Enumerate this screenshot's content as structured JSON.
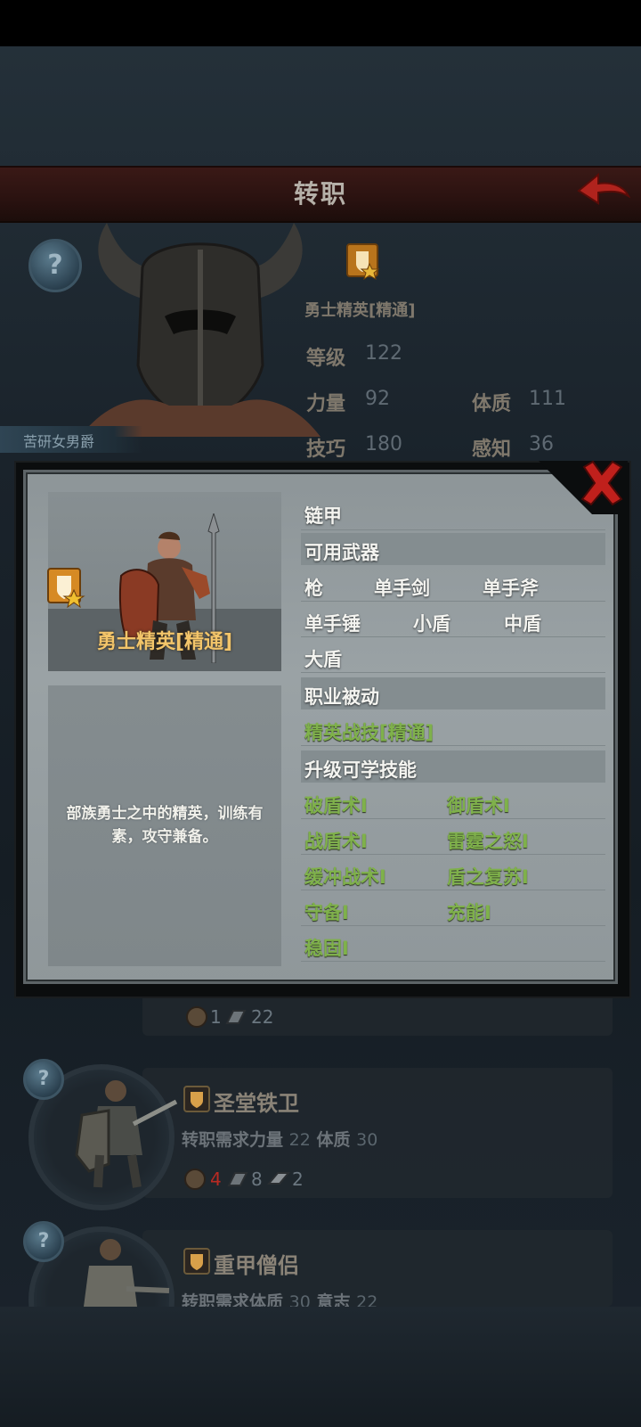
{
  "header": {
    "title": "转职"
  },
  "current_class": {
    "name": "勇士精英[精通]",
    "stats": [
      {
        "label": "等级",
        "value": "122"
      },
      {
        "label": "力量",
        "value": "92"
      },
      {
        "label": "体质",
        "value": "111"
      },
      {
        "label": "技巧",
        "value": "180"
      },
      {
        "label": "感知",
        "value": "36"
      }
    ],
    "character_name": "苦研女男爵"
  },
  "list_items": [
    {
      "title": "",
      "resources": [
        "1",
        "22"
      ]
    },
    {
      "title": "圣堂铁卫",
      "req_prefix": "转职需求",
      "req": [
        {
          "label": "力量",
          "value": "22"
        },
        {
          "label": "体质",
          "value": "30"
        }
      ],
      "resources": [
        "4",
        "8",
        "2"
      ]
    },
    {
      "title": "重甲僧侣",
      "req_prefix": "转职需求",
      "req": [
        {
          "label": "体质",
          "value": "30"
        },
        {
          "label": "意志",
          "value": "22"
        }
      ]
    }
  ],
  "modal": {
    "unit_name": "勇士精英[精通]",
    "description": "部族勇士之中的精英，训练有素，攻守兼备。",
    "armor": "链甲",
    "weapons_header": "可用武器",
    "weapons": [
      "枪",
      "单手剑",
      "单手斧",
      "单手锤",
      "小盾",
      "中盾",
      "大盾"
    ],
    "passive_header": "职业被动",
    "passive": "精英战技[精通]",
    "skills_header": "升级可学技能",
    "skills": [
      "破盾术I",
      "御盾术I",
      "战盾术I",
      "雷霆之怒I",
      "缓冲战术I",
      "盾之复苏I",
      "守备I",
      "充能I",
      "稳固I"
    ]
  },
  "colors": {
    "accent_gold": "#f3c56a",
    "skill_green": "#7fb14b",
    "close_red": "#c0201c"
  }
}
